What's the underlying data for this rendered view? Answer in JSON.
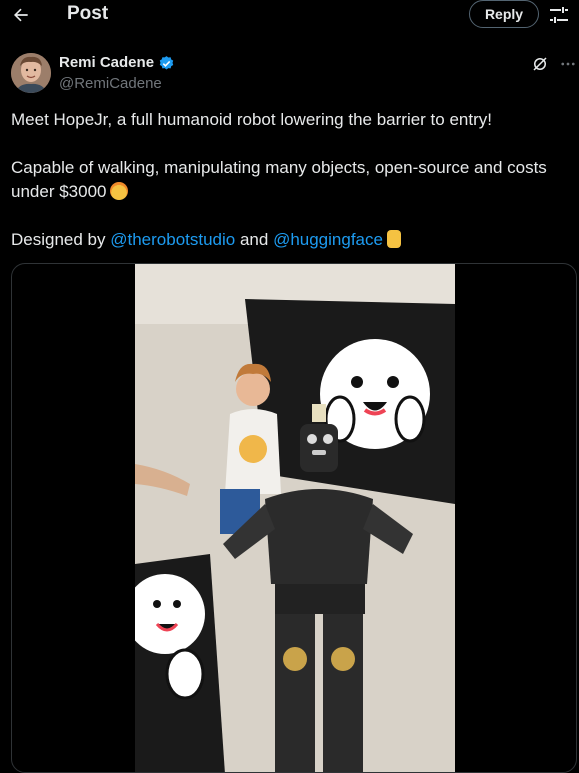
{
  "header": {
    "back_icon": "arrow-left-icon",
    "title": "Post",
    "reply_label": "Reply",
    "settings_icon": "sliders-icon"
  },
  "author": {
    "name": "Remi Cadene",
    "handle": "@RemiCadene",
    "verified": true,
    "verified_color": "#1d9bf0"
  },
  "tweet": {
    "line1": "Meet HopeJr, a full humanoid robot lowering the barrier to entry!",
    "line2": "Capable of walking, manipulating many objects, open-source and costs under $3000",
    "line2_emoji": "exploding-head-emoji",
    "line3_prefix": "Designed by ",
    "mention1": "@therobotstudio",
    "line3_mid": " and ",
    "mention2": "@huggingface",
    "line3_emoji": "pointing-down-emoji"
  },
  "colors": {
    "background": "#000000",
    "text": "#e7e9ea",
    "muted": "#71767b",
    "link": "#1d9bf0",
    "border": "#2f3336"
  }
}
